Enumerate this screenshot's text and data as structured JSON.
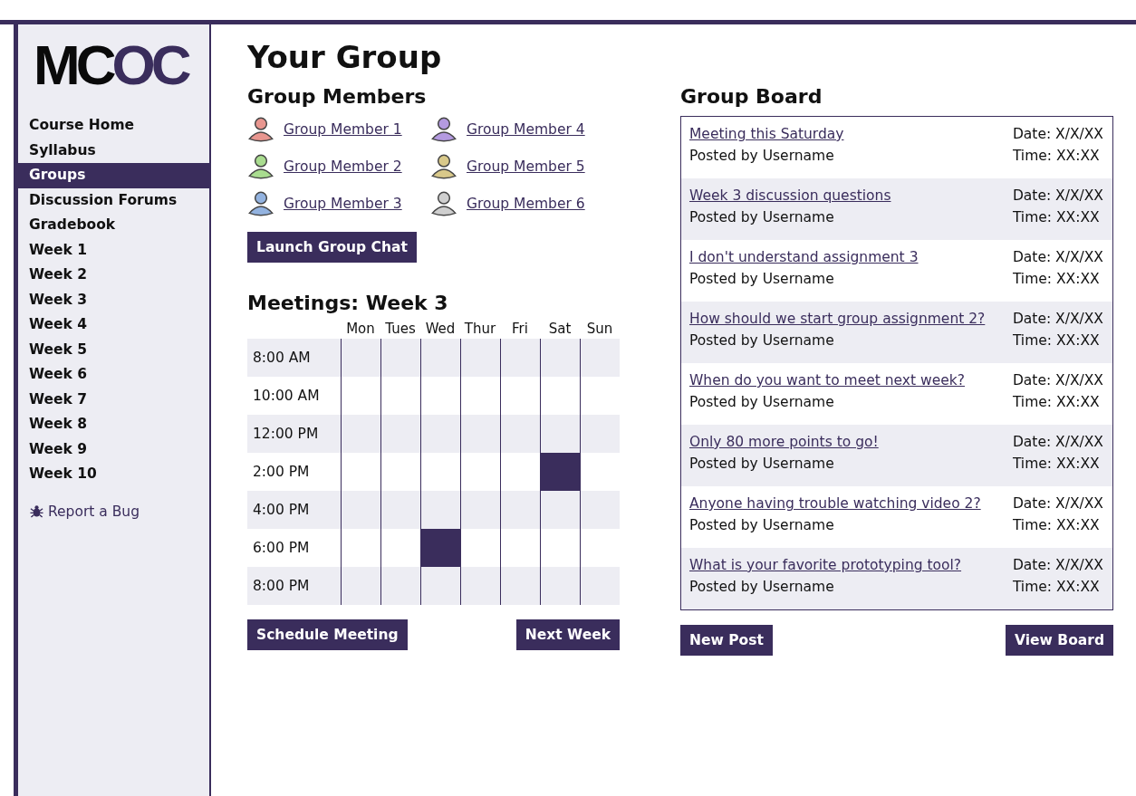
{
  "logo": {
    "dark": "MC",
    "accent": "OC"
  },
  "sidebar": {
    "items": [
      {
        "label": "Course Home",
        "selected": false
      },
      {
        "label": "Syllabus",
        "selected": false
      },
      {
        "label": "Groups",
        "selected": true
      },
      {
        "label": "Discussion Forums",
        "selected": false
      },
      {
        "label": "Gradebook",
        "selected": false
      },
      {
        "label": "Week 1",
        "selected": false
      },
      {
        "label": "Week 2",
        "selected": false
      },
      {
        "label": "Week 3",
        "selected": false
      },
      {
        "label": "Week 4",
        "selected": false
      },
      {
        "label": "Week 5",
        "selected": false
      },
      {
        "label": "Week 6",
        "selected": false
      },
      {
        "label": "Week 7",
        "selected": false
      },
      {
        "label": "Week 8",
        "selected": false
      },
      {
        "label": "Week 9",
        "selected": false
      },
      {
        "label": "Week 10",
        "selected": false
      }
    ],
    "report_link": "Report a Bug"
  },
  "page_title": "Your Group",
  "members": {
    "title": "Group Members",
    "items": [
      {
        "name": "Group Member 1",
        "color": "#e8968f"
      },
      {
        "name": "Group Member 4",
        "color": "#b49ae0"
      },
      {
        "name": "Group Member 2",
        "color": "#a9dc8f"
      },
      {
        "name": "Group Member 5",
        "color": "#d9c98a"
      },
      {
        "name": "Group Member 3",
        "color": "#93b3e0"
      },
      {
        "name": "Group Member 6",
        "color": "#cfcfcf"
      }
    ],
    "button": "Launch Group Chat"
  },
  "meetings": {
    "title": "Meetings: Week 3",
    "days": [
      "Mon",
      "Tues",
      "Wed",
      "Thur",
      "Fri",
      "Sat",
      "Sun"
    ],
    "rows": [
      {
        "time": "8:00 AM",
        "booked": [
          false,
          false,
          false,
          false,
          false,
          false,
          false
        ]
      },
      {
        "time": "10:00 AM",
        "booked": [
          false,
          false,
          false,
          false,
          false,
          false,
          false
        ]
      },
      {
        "time": "12:00 PM",
        "booked": [
          false,
          false,
          false,
          false,
          false,
          false,
          false
        ]
      },
      {
        "time": "2:00 PM",
        "booked": [
          false,
          false,
          false,
          false,
          false,
          true,
          false
        ]
      },
      {
        "time": "4:00 PM",
        "booked": [
          false,
          false,
          false,
          false,
          false,
          false,
          false
        ]
      },
      {
        "time": "6:00 PM",
        "booked": [
          false,
          false,
          true,
          false,
          false,
          false,
          false
        ]
      },
      {
        "time": "8:00 PM",
        "booked": [
          false,
          false,
          false,
          false,
          false,
          false,
          false
        ]
      }
    ],
    "buttons": [
      "Schedule Meeting",
      "Next Week"
    ]
  },
  "board": {
    "title": "Group Board",
    "posts": [
      {
        "title": "Meeting this Saturday",
        "author": "Posted by Username",
        "date": "Date: X/X/XX",
        "time": "Time: XX:XX"
      },
      {
        "title": "Week 3 discussion questions",
        "author": "Posted by Username",
        "date": "Date: X/X/XX",
        "time": "Time: XX:XX"
      },
      {
        "title": "I don't understand assignment 3",
        "author": "Posted by Username",
        "date": "Date: X/X/XX",
        "time": "Time: XX:XX"
      },
      {
        "title": "How should we start group assignment 2?",
        "author": "Posted by Username",
        "date": "Date: X/X/XX",
        "time": "Time: XX:XX"
      },
      {
        "title": "When do you want to meet next week?",
        "author": "Posted by Username",
        "date": "Date: X/X/XX",
        "time": "Time: XX:XX"
      },
      {
        "title": "Only 80 more points to go!",
        "author": "Posted by Username",
        "date": "Date: X/X/XX",
        "time": "Time: XX:XX"
      },
      {
        "title": "Anyone having trouble watching video 2?",
        "author": "Posted by Username",
        "date": "Date: X/X/XX",
        "time": "Time: XX:XX"
      },
      {
        "title": "What is your favorite prototyping tool?",
        "author": "Posted by Username",
        "date": "Date: X/X/XX",
        "time": "Time: XX:XX"
      }
    ],
    "buttons": [
      "New Post",
      "View Board"
    ]
  }
}
